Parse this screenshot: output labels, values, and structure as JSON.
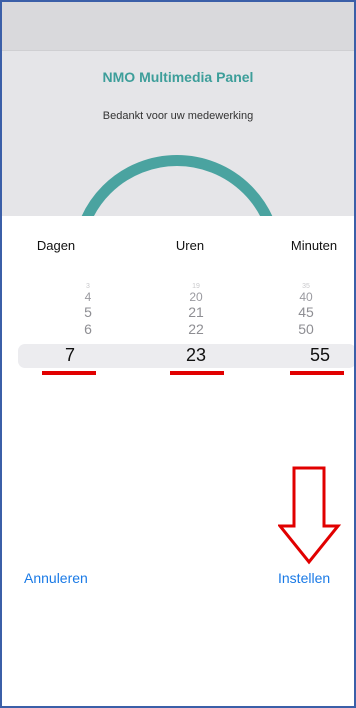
{
  "header": {
    "title": "NMO Multimedia Panel",
    "subtitle": "Bedankt voor uw medewerking"
  },
  "picker": {
    "columns": [
      {
        "header": "Dagen",
        "items": [
          "3",
          "4",
          "5",
          "6"
        ],
        "selected": "7"
      },
      {
        "header": "Uren",
        "items": [
          "19",
          "20",
          "21",
          "22"
        ],
        "selected": "23"
      },
      {
        "header": "Minuten",
        "items": [
          "35",
          "40",
          "45",
          "50"
        ],
        "selected": "55"
      }
    ]
  },
  "buttons": {
    "cancel_label": "Annuleren",
    "confirm_label": "Instellen"
  },
  "colors": {
    "accent": "#4aa3a0",
    "link": "#1a7ae6",
    "annotation": "#e10000"
  },
  "annotations": {
    "arrow": "down-arrow-icon"
  }
}
